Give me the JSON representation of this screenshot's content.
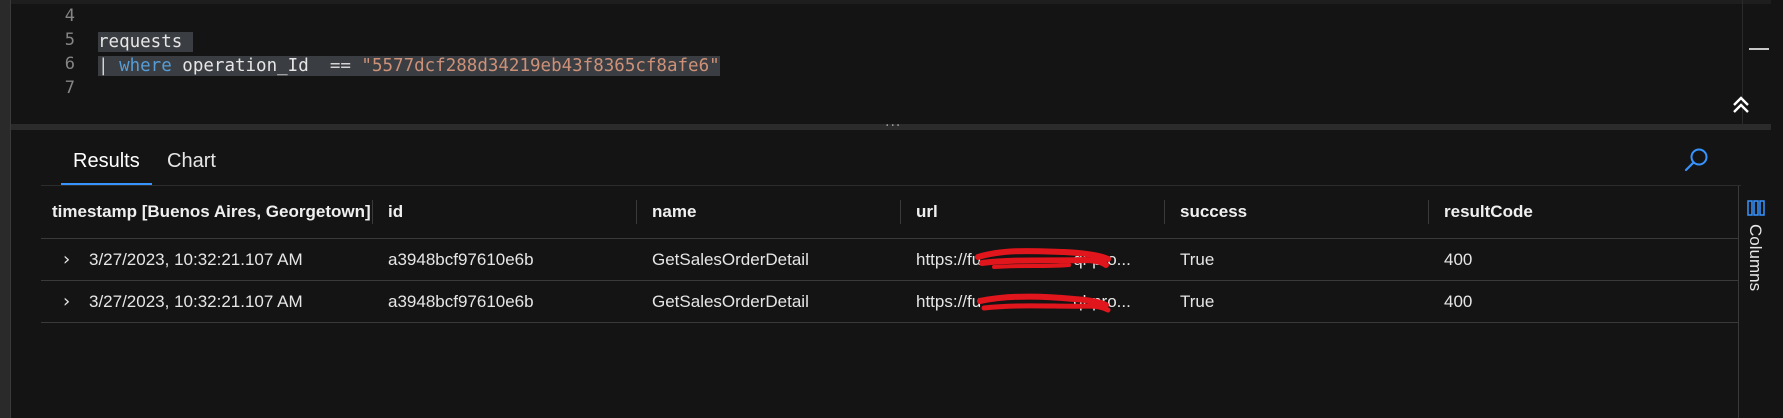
{
  "editor": {
    "line_numbers": [
      "4",
      "5",
      "6",
      "7"
    ],
    "line5": "requests",
    "line6": {
      "pipe": "| ",
      "keyword": "where",
      "field": " operation_Id  ",
      "operator": "==",
      "value": " \"5577dcf288d34219eb43f8365cf8afe6\""
    },
    "collapse_icon": "double-chevron-up-icon"
  },
  "tabs": [
    {
      "label": "Results",
      "active": true
    },
    {
      "label": "Chart",
      "active": false
    }
  ],
  "search_icon": "search-icon",
  "table": {
    "columns": [
      "timestamp [Buenos Aires, Georgetown]",
      "id",
      "name",
      "url",
      "success",
      "resultCode"
    ],
    "rows": [
      {
        "timestamp": "3/27/2023, 10:32:21.107 AM",
        "id": "a3948bcf97610e6b",
        "name": "GetSalesOrderDetail",
        "url": "https://fu",
        "url_tail": "ql-pro...",
        "success": "True",
        "resultCode": "400"
      },
      {
        "timestamp": "3/27/2023, 10:32:21.107 AM",
        "id": "a3948bcf97610e6b",
        "name": "GetSalesOrderDetail",
        "url": "https://fu",
        "url_tail": "ql-pro...",
        "success": "True",
        "resultCode": "400"
      }
    ]
  },
  "columns_panel": {
    "label": "Columns",
    "icon": "columns-icon"
  },
  "colors": {
    "accent": "#3794ff",
    "redaction": "#e0161c",
    "string": "#ce9178",
    "keyword": "#569cd6"
  }
}
